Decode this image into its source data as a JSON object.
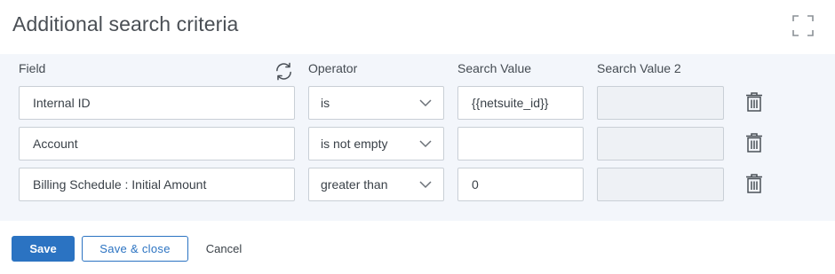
{
  "title": "Additional search criteria",
  "headers": {
    "field": "Field",
    "operator": "Operator",
    "value": "Search Value",
    "value2": "Search Value 2"
  },
  "rows": [
    {
      "field": "Internal ID",
      "operator": "is",
      "value": "{{netsuite_id}}",
      "value2": ""
    },
    {
      "field": "Account",
      "operator": "is not empty",
      "value": "",
      "value2": ""
    },
    {
      "field": "Billing Schedule : Initial Amount",
      "operator": "greater than",
      "value": "0",
      "value2": ""
    }
  ],
  "buttons": {
    "save": "Save",
    "save_close": "Save & close",
    "cancel": "Cancel"
  },
  "icons": {
    "expand": "expand-icon",
    "refresh": "refresh-icon",
    "dropdown": "chevron-down-icon",
    "delete": "trash-icon"
  },
  "colors": {
    "accent": "#2b73c2",
    "panel_bg": "#f3f6fb",
    "disabled_input": "#eef1f5"
  }
}
